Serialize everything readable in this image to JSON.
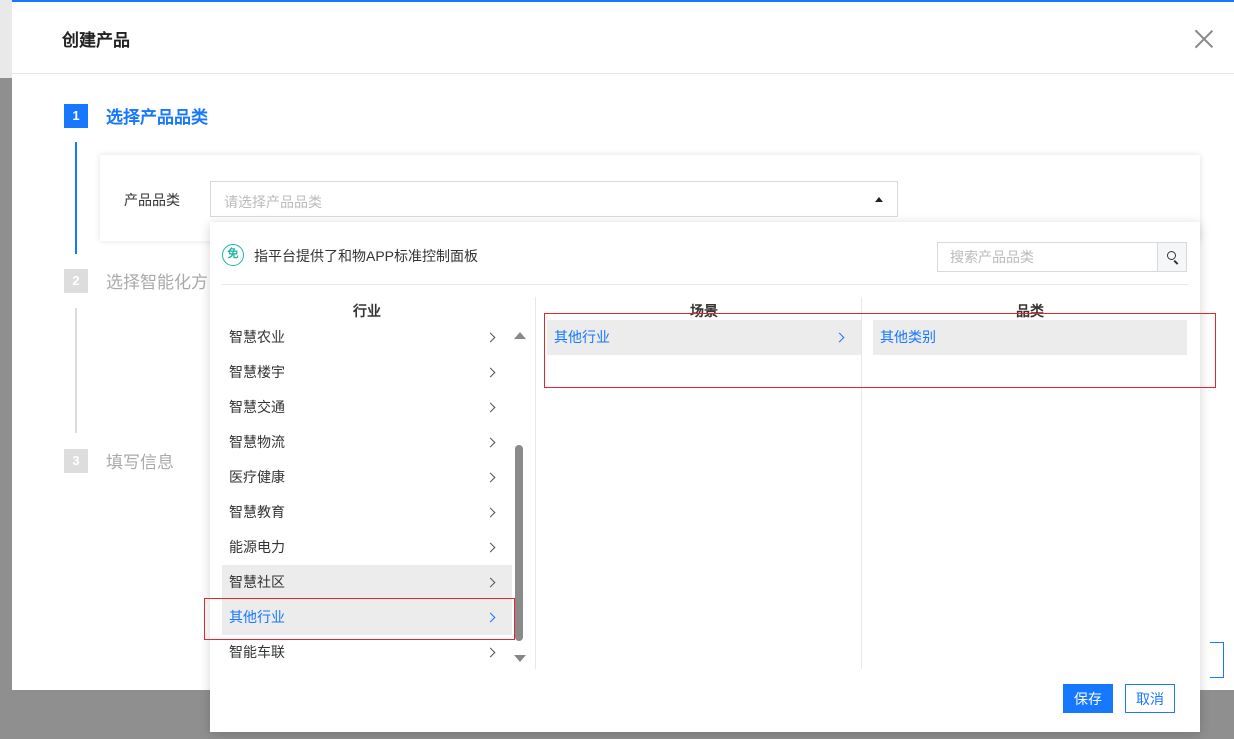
{
  "modal": {
    "title": "创建产品"
  },
  "steps": [
    {
      "number": "1",
      "label": "选择产品品类"
    },
    {
      "number": "2",
      "label": "选择智能化方"
    },
    {
      "number": "3",
      "label": "填写信息"
    }
  ],
  "form": {
    "category_label": "产品品类",
    "category_placeholder": "请选择产品品类"
  },
  "dropdown": {
    "badge_glyph": "免",
    "notice": "指平台提供了和物APP标准控制面板",
    "search_placeholder": "搜索产品品类",
    "columns": {
      "industry": {
        "header": "行业",
        "items": [
          "智慧农业",
          "智慧楼宇",
          "智慧交通",
          "智慧物流",
          "医疗健康",
          "智慧教育",
          "能源电力",
          "智慧社区",
          "其他行业",
          "智能车联"
        ]
      },
      "scene": {
        "header": "场景",
        "items": [
          "其他行业"
        ]
      },
      "category": {
        "header": "品类",
        "items": [
          "其他类别"
        ]
      }
    },
    "save_label": "保存",
    "cancel_label": "取消"
  },
  "colors": {
    "accent": "#1677ff",
    "highlight": "#e0282e",
    "badge": "#1bb5a5"
  }
}
